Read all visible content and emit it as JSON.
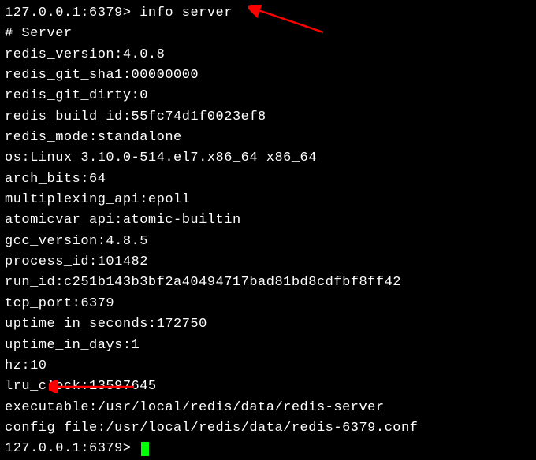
{
  "prompt1": "127.0.0.1:6379> ",
  "command": "info server",
  "header": "# Server",
  "lines": {
    "redis_version": "redis_version:4.0.8",
    "redis_git_sha1": "redis_git_sha1:00000000",
    "redis_git_dirty": "redis_git_dirty:0",
    "redis_build_id": "redis_build_id:55fc74d1f0023ef8",
    "redis_mode": "redis_mode:standalone",
    "os": "os:Linux 3.10.0-514.el7.x86_64 x86_64",
    "arch_bits": "arch_bits:64",
    "multiplexing_api": "multiplexing_api:epoll",
    "atomicvar_api": "atomicvar_api:atomic-builtin",
    "gcc_version": "gcc_version:4.8.5",
    "process_id": "process_id:101482",
    "run_id": "run_id:c251b143b3bf2a40494717bad81bd8cdfbf8ff42",
    "tcp_port": "tcp_port:6379",
    "uptime_in_seconds": "uptime_in_seconds:172750",
    "uptime_in_days": "uptime_in_days:1",
    "hz": "hz:10",
    "lru_clock": "lru_clock:13597645",
    "executable": "executable:/usr/local/redis/data/redis-server",
    "config_file": "config_file:/usr/local/redis/data/redis-6379.conf"
  },
  "prompt2": "127.0.0.1:6379> ",
  "annotation_color": "#ff0000"
}
